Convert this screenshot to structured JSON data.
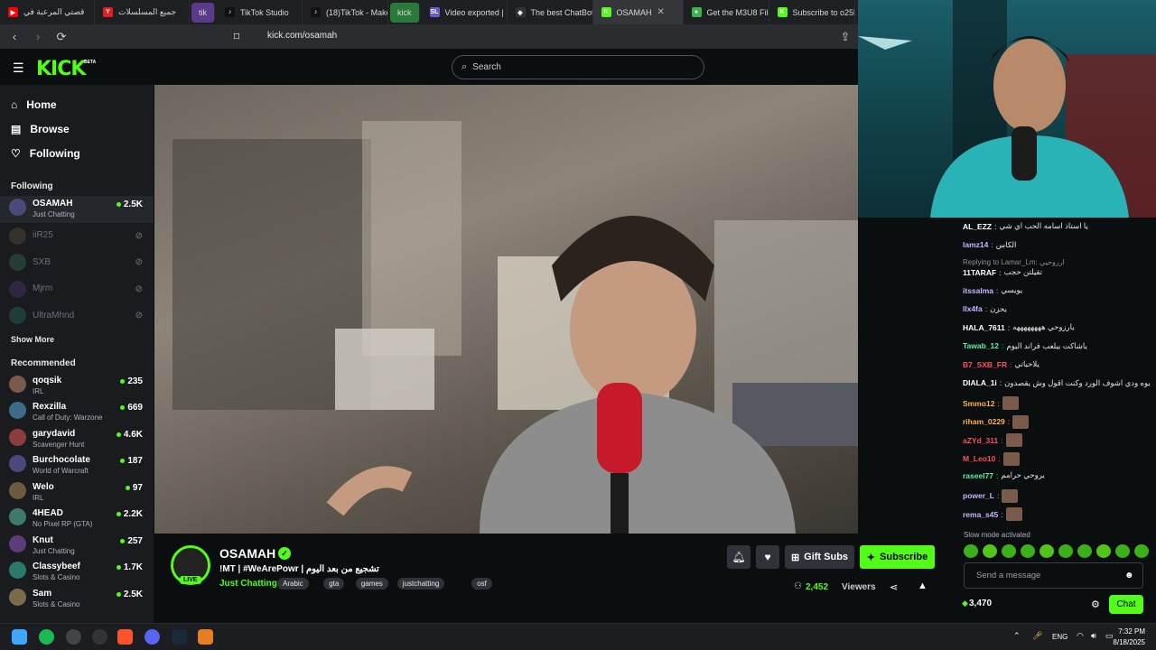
{
  "tabs": [
    {
      "label": "قصتي المرعبة في",
      "fav": "▶",
      "color": "#ff0000"
    },
    {
      "label": "جميع المسلسلات",
      "fav": "Y",
      "color": "#e02020"
    },
    {
      "label": "tik",
      "pill": true,
      "color": "#5c3a8a"
    },
    {
      "label": "TikTok Studio",
      "fav": "♪",
      "color": "#111"
    },
    {
      "label": "(18)TikTok - Make",
      "fav": "♪",
      "color": "#111"
    },
    {
      "label": "kick",
      "pill": true,
      "color": "#2a7a3a"
    },
    {
      "label": "Video exported | S",
      "fav": "SL",
      "color": "#6a5acd"
    },
    {
      "label": "The best ChatBot",
      "fav": "◆",
      "color": "#333"
    },
    {
      "label": "OSAMAH",
      "fav": "K",
      "color": "#53fc18",
      "active": true,
      "close": "✕"
    },
    {
      "label": "Get the M3U8 File",
      "fav": "●",
      "color": "#3bb54a"
    },
    {
      "label": "Subscribe to o25k",
      "fav": "K",
      "color": "#53fc18"
    }
  ],
  "address_bar": {
    "url": "kick.com/osamah"
  },
  "header": {
    "logo": "KICK",
    "beta": "BETA",
    "search_placeholder": "Search"
  },
  "sidebar": {
    "nav": [
      {
        "label": "Home",
        "icon": "home-icon"
      },
      {
        "label": "Browse",
        "icon": "browse-icon"
      },
      {
        "label": "Following",
        "icon": "heart-icon"
      }
    ],
    "following_title": "Following",
    "following": [
      {
        "name": "OSAMAH",
        "category": "Just Chatting",
        "viewers": "2.5K",
        "live": true
      },
      {
        "name": "iiR25",
        "live": false
      },
      {
        "name": "SXB",
        "live": false
      },
      {
        "name": "Mjrm",
        "live": false
      },
      {
        "name": "UltraMhnd",
        "live": false
      }
    ],
    "show_more": "Show More",
    "recommended_title": "Recommended",
    "recommended": [
      {
        "name": "qoqsik",
        "category": "IRL",
        "viewers": "235"
      },
      {
        "name": "Rexzilla",
        "category": "Call of Duty: Warzone",
        "viewers": "669"
      },
      {
        "name": "garydavid",
        "category": "Scavenger Hunt",
        "viewers": "4.6K"
      },
      {
        "name": "Burchocolate",
        "category": "World of Warcraft",
        "viewers": "187"
      },
      {
        "name": "Welo",
        "category": "IRL",
        "viewers": "97"
      },
      {
        "name": "4HEAD",
        "category": "No Pixel RP (GTA)",
        "viewers": "2.2K"
      },
      {
        "name": "Knut",
        "category": "Just Chatting",
        "viewers": "257"
      },
      {
        "name": "Classybeef",
        "category": "Slots & Casino",
        "viewers": "1.7K"
      },
      {
        "name": "Sam",
        "category": "Slots & Casino",
        "viewers": "2.5K"
      }
    ]
  },
  "stream": {
    "name": "OSAMAH",
    "live_badge": "LIVE",
    "title": "!MT |  #WeArePowr | تشجيع من بعد اليوم",
    "category": "Just Chatting",
    "tags": [
      "Arabic",
      "gta",
      "games",
      "justchatting",
      "osf"
    ],
    "viewers": "2,452",
    "viewers_label": "Viewers",
    "gift_label": "Gift Subs",
    "subscribe_label": "Subscribe"
  },
  "chat": {
    "messages": [
      {
        "user": "AL_EZZ",
        "color": "#ffffff",
        "text": "يا استاذ اسامه الحب اي شي"
      },
      {
        "user": "lamz14",
        "color": "#c9b3ff",
        "text": "الكاس"
      },
      {
        "reply": "Replying to Lamar_Lm: ارروحيي"
      },
      {
        "user": "11TARAF",
        "color": "#ffffff",
        "text": "تقيلتن حجب"
      },
      {
        "user": "itssalma",
        "color": "#c9b3ff",
        "text": "يويسي"
      },
      {
        "user": "llx4fa",
        "color": "#c9b3ff",
        "text": "يحزن"
      },
      {
        "user": "HALA_7611",
        "color": "#ffffff",
        "text": "يارزوحي ههههههههه"
      },
      {
        "user": "Tawab_12",
        "color": "#5cf0a0",
        "text": "ياشاكت بيلعب فراند اليوم"
      },
      {
        "user": "B7_SXB_FR",
        "color": "#ff4d5e",
        "text": "يلاحياتي"
      },
      {
        "user": "DIALA_1i",
        "color": "#ffffff",
        "text": "يوه ودي اشوف الورد وكنت اقول وش يقصدون"
      },
      {
        "user": "Smmo12",
        "color": "#ffb347",
        "emote": true
      },
      {
        "user": "riham_0229",
        "color": "#ffb347",
        "emote": true
      },
      {
        "user": "aZYd_311",
        "color": "#ff4d5e",
        "emote": true
      },
      {
        "user": "M_Leo10",
        "color": "#ff4d5e",
        "emote": true
      },
      {
        "user": "raseel77",
        "color": "#5cf0a0",
        "text": "يروحي حرامم"
      },
      {
        "user": "power_L",
        "color": "#c9b3ff",
        "emote": true
      },
      {
        "user": "rema_s45",
        "color": "#c9b3ff",
        "emote": true
      }
    ],
    "slow_mode": "Slow mode activated",
    "input_placeholder": "Send a message",
    "points": "3,470",
    "chat_button": "Chat"
  },
  "taskbar": {
    "lang": "ENG",
    "time": "7:32 PM",
    "date": "8/18/2025"
  },
  "colors": {
    "accent": "#53fc18",
    "bg": "#0b0e0f",
    "sidebar": "#191b1f"
  }
}
